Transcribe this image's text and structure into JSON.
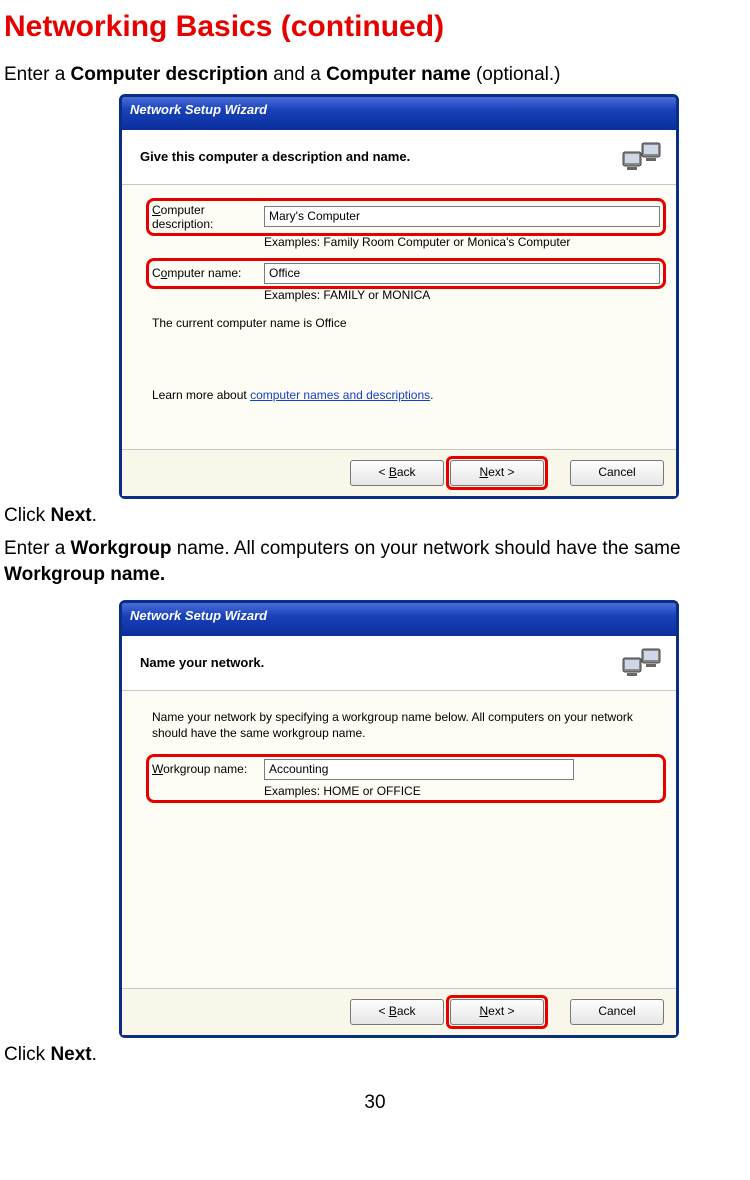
{
  "page": {
    "title": "Networking Basics (continued)",
    "page_number": "30"
  },
  "instr": {
    "step1_pre": "Enter a ",
    "step1_b1": "Computer description",
    "step1_mid": " and a ",
    "step1_b2": "Computer name",
    "step1_post": " (optional.)",
    "click_next_pre": "Click ",
    "click_next_b": "Next",
    "click_next_post": ".",
    "step2_pre": "Enter a ",
    "step2_b1": "Workgroup",
    "step2_mid": " name. All computers on your network should have the same ",
    "step2_b2": "Workgroup name.",
    "click_next2_pre": "Click ",
    "click_next2_b": "Next",
    "click_next2_post": "."
  },
  "wiz1": {
    "title": "Network Setup Wizard",
    "heading": "Give this computer a description and name.",
    "desc_label": "Computer description:",
    "desc_value": "Mary's Computer",
    "desc_example": "Examples: Family Room Computer or Monica's Computer",
    "name_label": "Computer name:",
    "name_value": "Office",
    "name_example": "Examples: FAMILY or MONICA",
    "current_name_note": "The current computer name is Office",
    "learn_more_pre": "Learn more about ",
    "learn_more_link": "computer names and descriptions",
    "learn_more_post": ".",
    "btn_back": "Back",
    "btn_next": "Next >",
    "btn_cancel": "Cancel"
  },
  "wiz2": {
    "title": "Network Setup Wizard",
    "heading": "Name your network.",
    "intro": "Name your network by specifying a workgroup name below. All computers on your network should have the same workgroup name.",
    "wg_label": "Workgroup name:",
    "wg_value": "Accounting",
    "wg_example": "Examples: HOME or OFFICE",
    "btn_back": "Back",
    "btn_next": "Next >",
    "btn_cancel": "Cancel"
  }
}
